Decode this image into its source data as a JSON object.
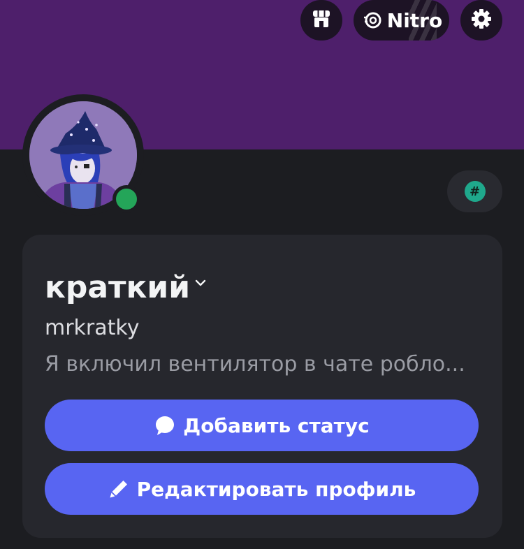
{
  "header": {
    "shop_icon": "shop-icon",
    "nitro_label": "Nitro",
    "nitro_icon": "nitro-icon",
    "settings_icon": "gear-icon"
  },
  "profile": {
    "display_name": "краткий",
    "username": "mrkratky",
    "custom_status": "Я включил вентилятор в чате робло...",
    "online_status": "online",
    "badge_icon": "hash-icon"
  },
  "actions": {
    "add_status_label": "Добавить статус",
    "add_status_icon": "chat-bubble-icon",
    "edit_profile_label": "Редактировать профиль",
    "edit_profile_icon": "pencil-icon"
  },
  "colors": {
    "banner": "#4e1f6b",
    "background": "#1c1d21",
    "card": "#26272d",
    "accent": "#5865f2",
    "online": "#24a559",
    "badge": "#1fa88c"
  }
}
